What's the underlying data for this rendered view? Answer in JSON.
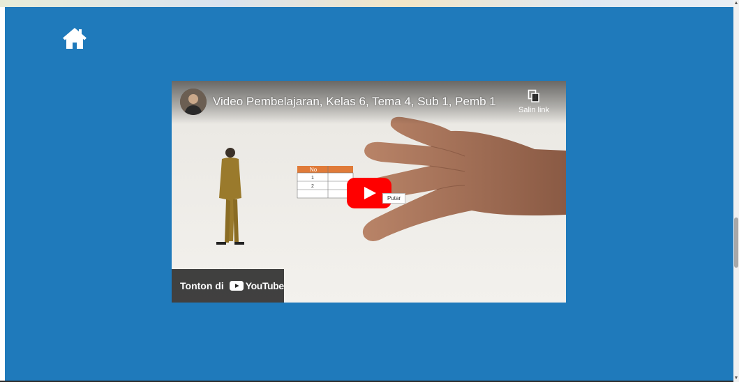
{
  "nav": {
    "home_icon": "home-icon"
  },
  "video": {
    "title": "Video Pembelajaran, Kelas 6, Tema 4, Sub 1, Pemb 1",
    "copy_link_label": "Salin link",
    "play_tooltip": "Putar",
    "watch_on_label": "Tonton di",
    "youtube_label": "YouTube",
    "table_header": "No",
    "table_rows": [
      "1",
      "2"
    ]
  },
  "colors": {
    "page_background": "#1f7abb",
    "youtube_red": "#ff0000",
    "table_header": "#e07b39"
  }
}
